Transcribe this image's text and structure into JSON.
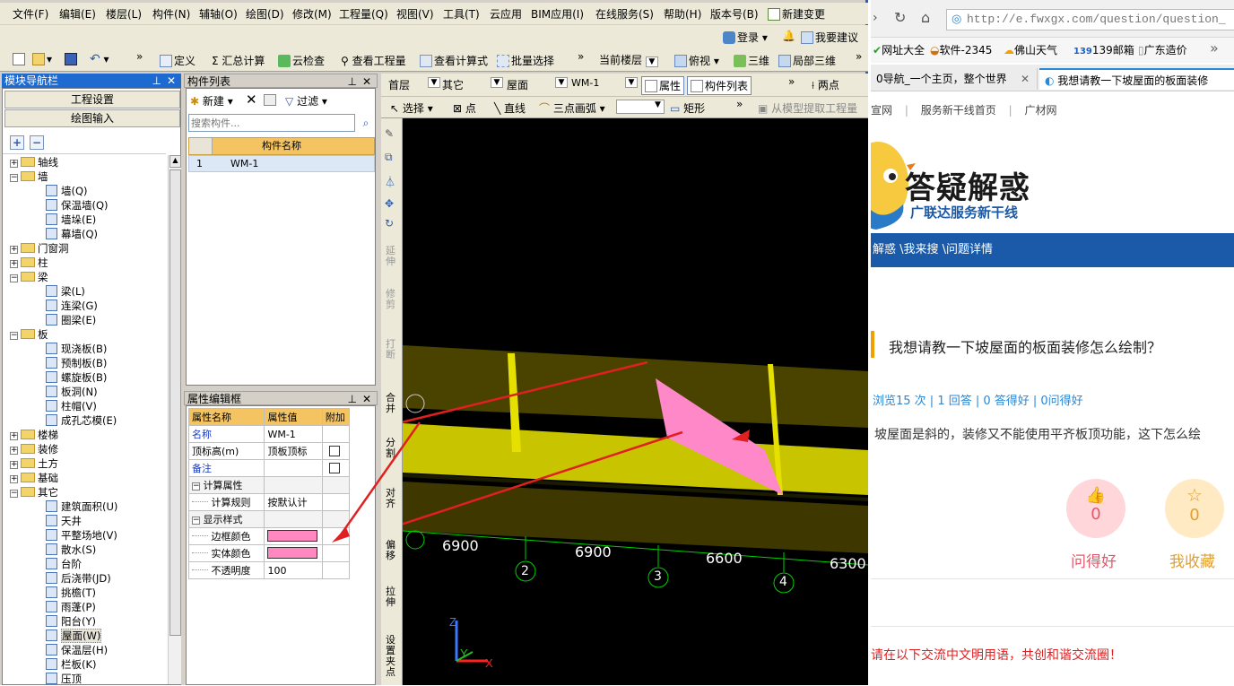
{
  "menubar": {
    "items": [
      "文件(F)",
      "编辑(E)",
      "楼层(L)",
      "构件(N)",
      "辅轴(O)",
      "绘图(D)",
      "修改(M)",
      "工程量(Q)",
      "视图(V)",
      "工具(T)",
      "云应用",
      "BIM应用(I)",
      "在线服务(S)",
      "帮助(H)",
      "版本号(B)",
      "新建变更"
    ]
  },
  "toolbar_top": {
    "login": "登录",
    "suggest": "我要建议"
  },
  "toolbar_main": {
    "define": "定义",
    "sum": "汇总计算",
    "cloud_check": "云检查",
    "view_qty": "查看工程量",
    "view_formula": "查看计算式",
    "batch_select": "批量选择",
    "current_floor": "当前楼层",
    "top_view": "俯视",
    "three_d": "三维",
    "local_3d": "局部三维"
  },
  "nav_panel": {
    "title": "模块导航栏",
    "project_settings": "工程设置",
    "drawing_input": "绘图输入",
    "tree": [
      {
        "type": "folder",
        "label": "轴线",
        "expanded": false
      },
      {
        "type": "folder",
        "label": "墙",
        "expanded": true
      },
      {
        "type": "leaf",
        "label": "墙(Q)"
      },
      {
        "type": "leaf",
        "label": "保温墙(Q)"
      },
      {
        "type": "leaf",
        "label": "墙垛(E)"
      },
      {
        "type": "leaf",
        "label": "幕墙(Q)"
      },
      {
        "type": "folder",
        "label": "门窗洞",
        "expanded": false
      },
      {
        "type": "folder",
        "label": "柱",
        "expanded": false
      },
      {
        "type": "folder",
        "label": "梁",
        "expanded": true
      },
      {
        "type": "leaf",
        "label": "梁(L)"
      },
      {
        "type": "leaf",
        "label": "连梁(G)"
      },
      {
        "type": "leaf",
        "label": "圈梁(E)"
      },
      {
        "type": "folder",
        "label": "板",
        "expanded": true
      },
      {
        "type": "leaf",
        "label": "现浇板(B)"
      },
      {
        "type": "leaf",
        "label": "预制板(B)"
      },
      {
        "type": "leaf",
        "label": "螺旋板(B)"
      },
      {
        "type": "leaf",
        "label": "板洞(N)"
      },
      {
        "type": "leaf",
        "label": "柱帽(V)"
      },
      {
        "type": "leaf",
        "label": "成孔芯模(E)"
      },
      {
        "type": "folder",
        "label": "楼梯",
        "expanded": false
      },
      {
        "type": "folder",
        "label": "装修",
        "expanded": false
      },
      {
        "type": "folder",
        "label": "土方",
        "expanded": false
      },
      {
        "type": "folder",
        "label": "基础",
        "expanded": false
      },
      {
        "type": "folder",
        "label": "其它",
        "expanded": true
      },
      {
        "type": "leaf",
        "label": "建筑面积(U)"
      },
      {
        "type": "leaf",
        "label": "天井"
      },
      {
        "type": "leaf",
        "label": "平整场地(V)"
      },
      {
        "type": "leaf",
        "label": "散水(S)"
      },
      {
        "type": "leaf",
        "label": "台阶"
      },
      {
        "type": "leaf",
        "label": "后浇带(JD)"
      },
      {
        "type": "leaf",
        "label": "挑檐(T)"
      },
      {
        "type": "leaf",
        "label": "雨蓬(P)"
      },
      {
        "type": "leaf",
        "label": "阳台(Y)"
      },
      {
        "type": "leaf",
        "label": "屋面(W)",
        "selected": true
      },
      {
        "type": "leaf",
        "label": "保温层(H)"
      },
      {
        "type": "leaf",
        "label": "栏板(K)"
      },
      {
        "type": "leaf",
        "label": "压顶"
      }
    ]
  },
  "component_list": {
    "title": "构件列表",
    "new_label": "新建",
    "filter_label": "过滤",
    "search_placeholder": "搜索构件...",
    "col_header": "构件名称",
    "rows": [
      {
        "index": "1",
        "name": "WM-1"
      }
    ]
  },
  "property_editor": {
    "title": "属性编辑框",
    "headers": [
      "属性名称",
      "属性值",
      "附加"
    ],
    "rows": [
      {
        "indent": 0,
        "name": "名称",
        "value": "WM-1",
        "check": false,
        "link": true
      },
      {
        "indent": 0,
        "name": "顶标高(m)",
        "value": "顶板顶标",
        "check": true
      },
      {
        "indent": 0,
        "name": "备注",
        "value": "",
        "check": true,
        "link": true
      },
      {
        "indent": 0,
        "name": "计算属性",
        "value": "",
        "group": true
      },
      {
        "indent": 1,
        "name": "计算规则",
        "value": "按默认计"
      },
      {
        "indent": 0,
        "name": "显示样式",
        "value": "",
        "group": true
      },
      {
        "indent": 1,
        "name": "边框颜色",
        "value": "",
        "color": "#ff88c0"
      },
      {
        "indent": 1,
        "name": "实体颜色",
        "value": "",
        "color": "#ff88c0"
      },
      {
        "indent": 1,
        "name": "不透明度",
        "value": "100"
      }
    ]
  },
  "drawing_toolbar": {
    "floor": "首层",
    "type": "其它",
    "category": "屋面",
    "component": "WM-1",
    "attr_btn": "属性",
    "list_btn": "构件列表",
    "two_points": "两点",
    "select": "选择",
    "point": "点",
    "line": "直线",
    "arc": "三点画弧",
    "rect": "矩形",
    "extract": "从模型提取工程量"
  },
  "side_tools": [
    "延伸",
    "修剪",
    "打断",
    "合并",
    "分割",
    "对齐",
    "偏移",
    "拉伸",
    "设置夹点"
  ],
  "viewport": {
    "dims": [
      "6900",
      "6900",
      "6600",
      "6300"
    ],
    "axes": [
      "2",
      "3",
      "4"
    ],
    "axis_z": "Z",
    "axis_y": "Y",
    "axis_x": "X",
    "colors": {
      "beam": "#d4d000",
      "dark_beam": "#4b4400",
      "roof_face": "#ff88c8",
      "arrow": "#e02020",
      "axis": "#00d000"
    }
  },
  "browser": {
    "url": "http://e.fwxgx.com/question/question_",
    "bookmarks": [
      "网址大全",
      "软件-2345",
      "佛山天气",
      "139邮箱",
      "广东造价"
    ],
    "tabs": [
      "0导航_一个主页，整个世界",
      "我想请教一下坡屋面的板面装修"
    ],
    "nav_links": [
      "宣网",
      "服务新干线首页",
      "广材网"
    ],
    "brand_title": "答疑解惑",
    "brand_sub": "广联达服务新干线",
    "breadcrumb": "解惑 \\我来搜 \\问题详情",
    "question_title": "我想请教一下坡屋面的板面装修怎么绘制？",
    "stats": "浏览15 次 | 1 回答 | 0 答得好 | 0问得好",
    "question_body": "坡屋面是斜的，装修又不能使用平齐板顶功能，这下怎么绘",
    "like_count": "0",
    "like_label": "问得好",
    "fav_count": "0",
    "fav_label": "我收藏",
    "footer_note": "请在以下交流中文明用语，共创和谐交流圈！"
  }
}
